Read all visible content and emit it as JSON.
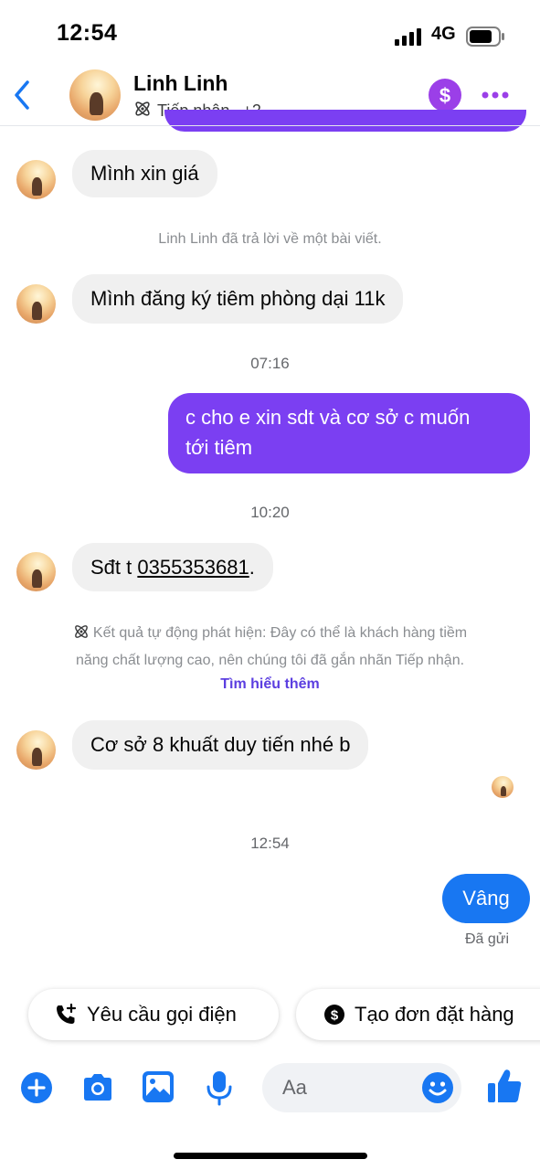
{
  "status_bar": {
    "time": "12:54",
    "network": "4G"
  },
  "header": {
    "name": "Linh Linh",
    "label_tag": "Tiếp nhận",
    "extra_count": "+2"
  },
  "messages": {
    "m1": "Mình xin giá",
    "reply_note": "Linh Linh đã trả lời về một bài viết.",
    "m2": "Mình đăng ký tiêm phòng dại 11k",
    "ts1": "07:16",
    "out1_line1": "c cho e xin sdt và cơ sở c muốn",
    "out1_line2": "tới tiêm",
    "ts2": "10:20",
    "m3_prefix": "Sđt t ",
    "m3_phone": "0355353681",
    "m3_suffix": ".",
    "auto_line1": "Kết quả tự động phát hiện: Đây có thể là khách hàng tiềm",
    "auto_line2": "năng chất lượng cao, nên chúng tôi đã gắn nhãn Tiếp nhận.",
    "learn_more": "Tìm hiểu thêm",
    "m4": "Cơ sở 8 khuất duy tiến nhé b",
    "ts3": "12:54",
    "out2": "Vâng",
    "sent_status": "Đã gửi"
  },
  "quick_actions": {
    "call_request": "Yêu cầu gọi điện",
    "create_order": "Tạo đơn đặt hàng"
  },
  "composer": {
    "placeholder": "Aa"
  },
  "colors": {
    "accent_purple": "#7b3ff2",
    "messenger_blue": "#1877f2",
    "bubble_gray": "#f0f0f0"
  }
}
